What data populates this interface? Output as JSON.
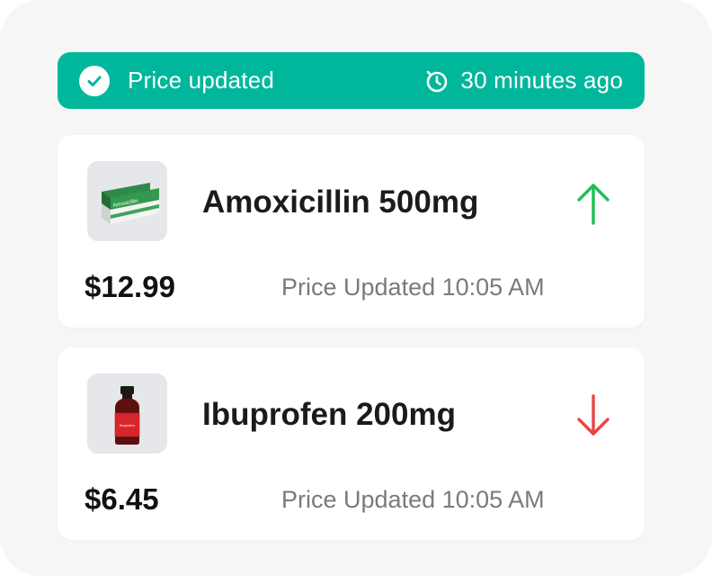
{
  "banner": {
    "title": "Price updated",
    "ago": "30 minutes ago",
    "color": "#00b79c",
    "check_icon": "check-circle-icon",
    "timer_icon": "stopwatch-icon"
  },
  "items": [
    {
      "name": "Amoxicillin 500mg",
      "price": "$12.99",
      "updated": "Price Updated 10:05 AM",
      "trend": "up",
      "trend_color": "#1fbf57",
      "box_label": "Amoxicillin"
    },
    {
      "name": "Ibuprofen 200mg",
      "price": "$6.45",
      "updated": "Price Updated 10:05 AM",
      "trend": "down",
      "trend_color": "#e94545",
      "bottle_label": "Ibuprofen"
    }
  ]
}
